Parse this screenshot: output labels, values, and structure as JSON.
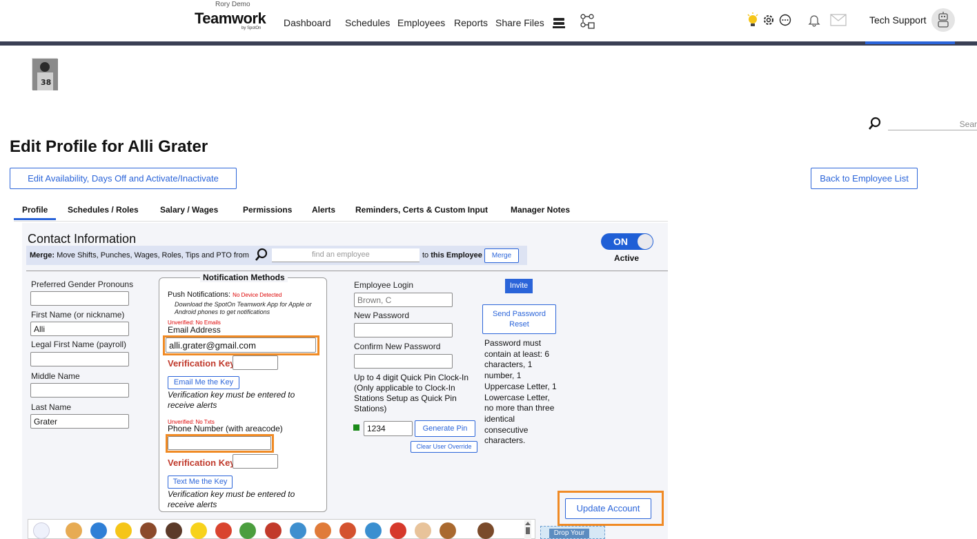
{
  "header": {
    "company": "Rory Demo",
    "logo": "Teamwork",
    "logo_sub": "by SpotOn",
    "nav": [
      "Dashboard",
      "Schedules",
      "Employees",
      "Reports",
      "Share Files"
    ],
    "user": "Tech Support"
  },
  "search": {
    "placeholder": "Sear"
  },
  "page": {
    "title": "Edit Profile for Alli Grater",
    "edit_availability_label": "Edit Availability, Days Off and Activate/Inactivate",
    "back_label": "Back to Employee List"
  },
  "tabs": [
    "Profile",
    "Schedules / Roles",
    "Salary / Wages",
    "Permissions",
    "Alerts",
    "Reminders, Certs & Custom Input",
    "Manager Notes"
  ],
  "contact": {
    "heading": "Contact Information",
    "merge_bold": "Merge:",
    "merge_text": "Move Shifts, Punches, Wages, Roles, Tips and PTO from",
    "merge_placeholder": "find an employee",
    "merge_to": "to",
    "merge_this": "this Employee",
    "merge_button": "Merge",
    "toggle": "ON",
    "toggle_label": "Active"
  },
  "left_fields": {
    "pronouns_label": "Preferred Gender Pronouns",
    "pronouns_value": "",
    "first_label": "First Name (or nickname)",
    "first_value": "Alli",
    "legal_label": "Legal First Name (payroll)",
    "legal_value": "",
    "middle_label": "Middle Name",
    "middle_value": "",
    "last_label": "Last Name",
    "last_value": "Grater"
  },
  "notifications": {
    "legend": "Notification Methods",
    "push_label": "Push Notifications:",
    "push_status": "No Device Detected",
    "push_help": "Download the SpotOn Teamwork App for Apple or Android phones to get notifications",
    "email_status": "Unverified: No Emails",
    "email_label": "Email Address",
    "email_value": "alli.grater@gmail.com",
    "vkey_label": "Verification Key",
    "email_key_value": "",
    "email_me_button": "Email Me the Key",
    "email_note": "Verification key must be entered to receive alerts",
    "phone_status": "Unverified: No Txts",
    "phone_label": "Phone Number (with areacode)",
    "phone_value": "",
    "phone_key_value": "",
    "text_me_button": "Text Me the Key",
    "phone_note": "Verification key must be entered to receive alerts"
  },
  "login": {
    "login_label": "Employee Login",
    "login_placeholder": "Brown, C",
    "new_pw_label": "New Password",
    "confirm_pw_label": "Confirm New Password",
    "pin_help": "Up to 4 digit Quick Pin Clock-In (Only applicable to Clock-In Stations Setup as Quick Pin Stations)",
    "pin_value": "1234",
    "generate_pin": "Generate Pin",
    "clear_override": "Clear User Override",
    "invite": "Invite",
    "send_reset": "Send Password Reset",
    "pw_rules": "Password must contain at least: 6 characters, 1 number, 1 Uppercase Letter, 1 Lowercase Letter, no more than three identical consecutive characters."
  },
  "update_button": "Update Account",
  "drop_label": "Drop Your",
  "colors": {
    "accent": "#2a64d9",
    "highlight": "#f08a24",
    "nav_bar": "#3a3f54",
    "toggle": "#1f5fd6",
    "red": "#c0392b"
  }
}
